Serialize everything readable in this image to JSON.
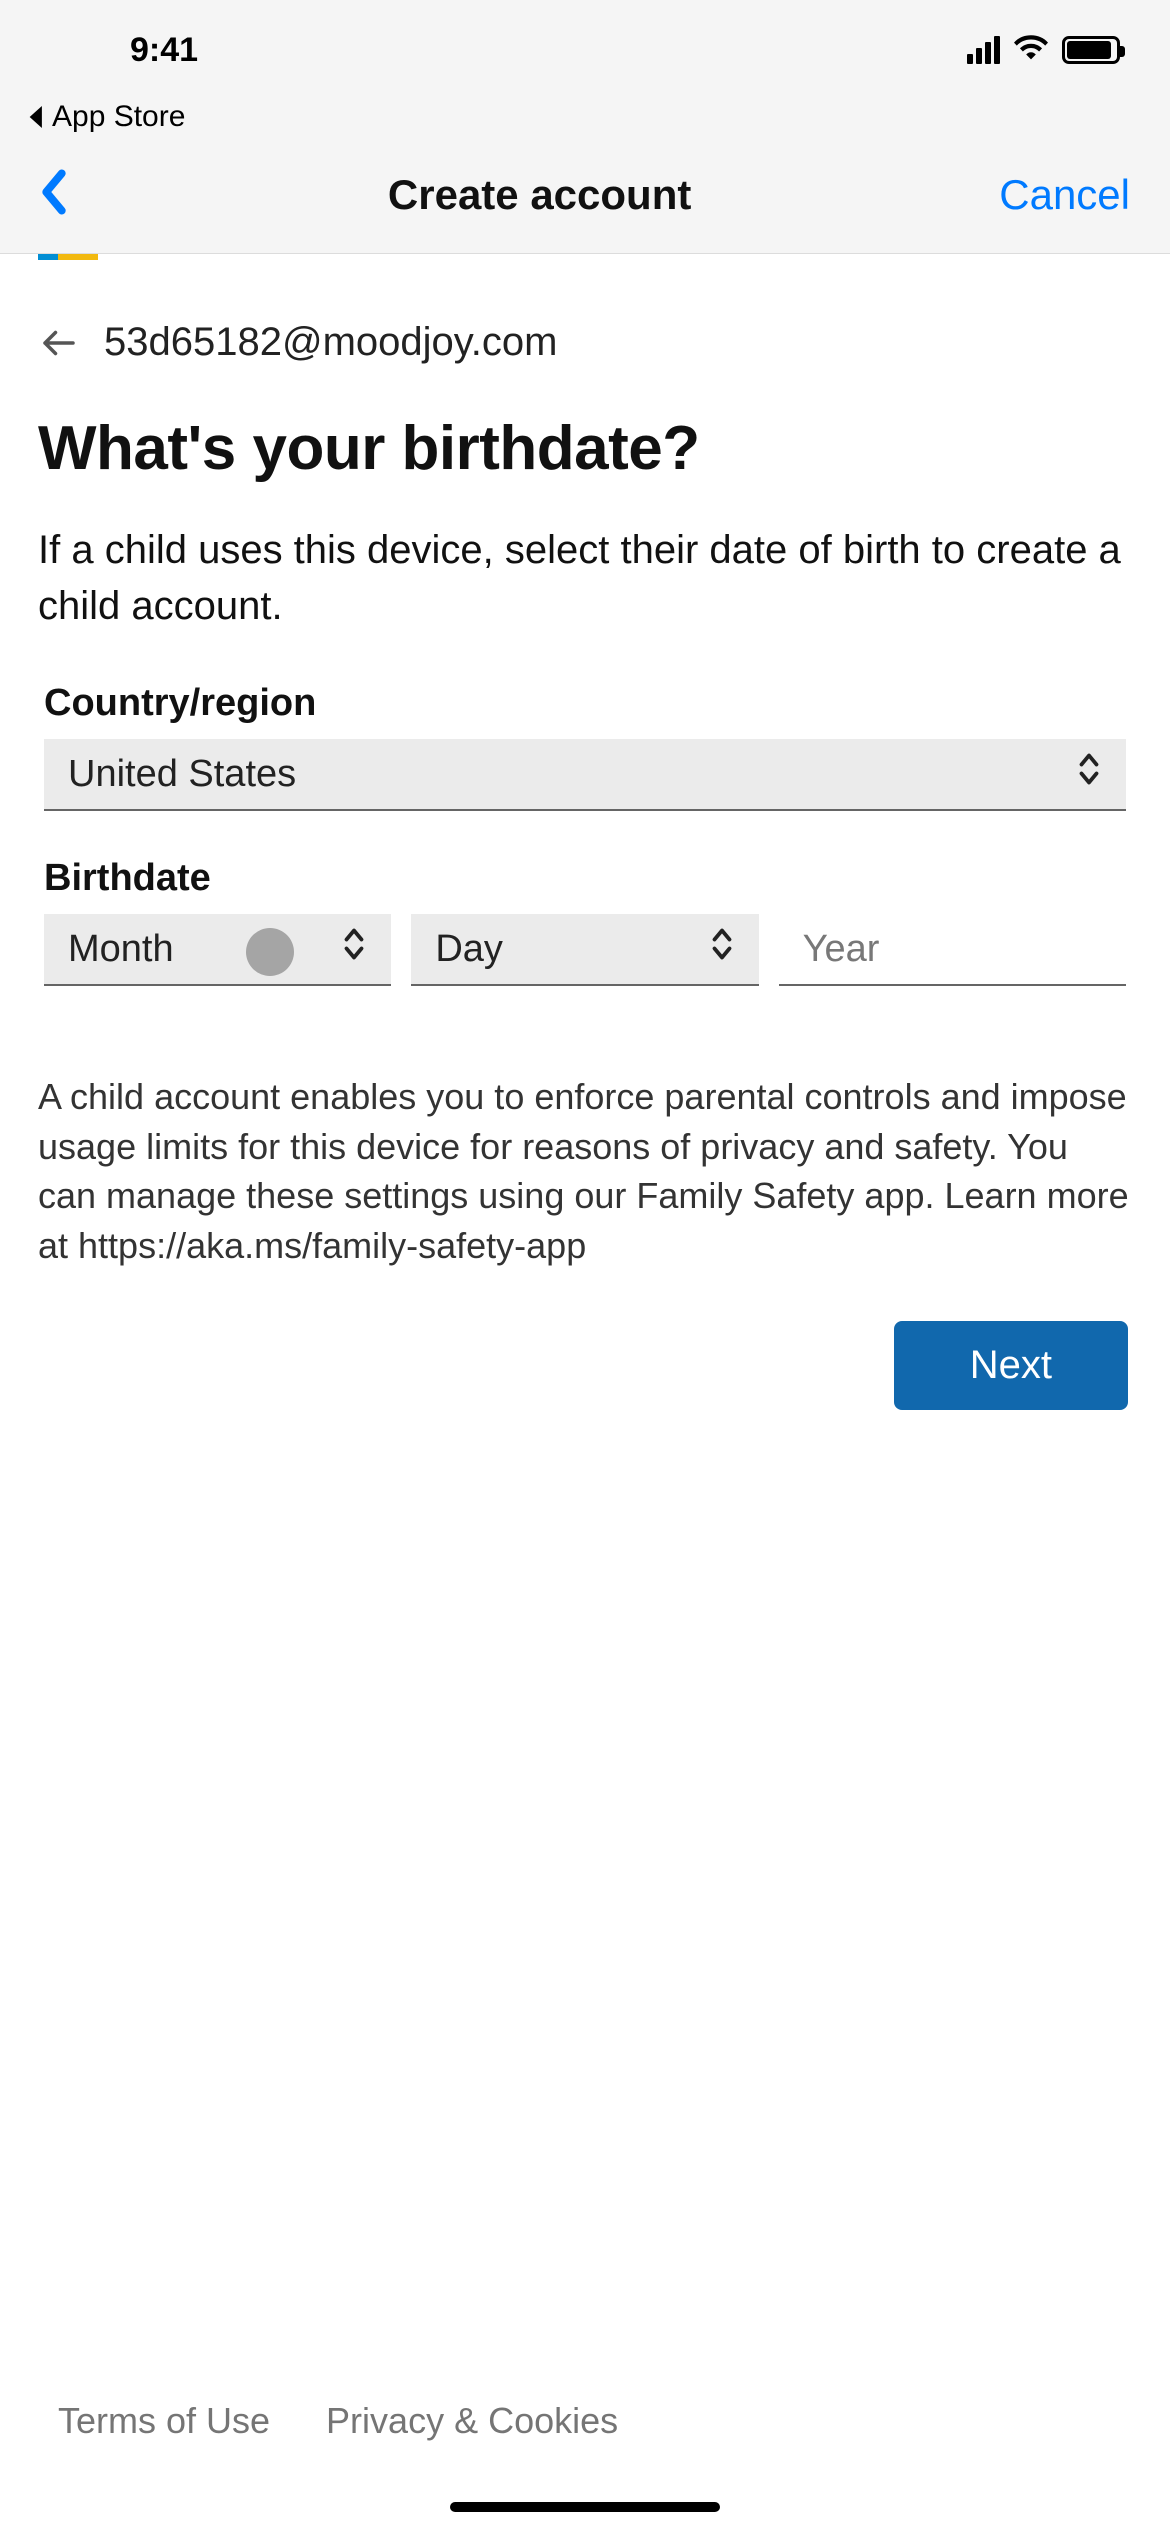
{
  "status": {
    "time": "9:41"
  },
  "return_app": {
    "label": "App Store"
  },
  "nav": {
    "title": "Create account",
    "cancel": "Cancel"
  },
  "account": {
    "email": "53d65182@moodjoy.com"
  },
  "heading": "What's your birthdate?",
  "instruction": "If a child uses this device, select their date of birth to create a child account.",
  "fields": {
    "country_label": "Country/region",
    "country_value": "United States",
    "birthdate_label": "Birthdate",
    "month_placeholder": "Month",
    "day_placeholder": "Day",
    "year_placeholder": "Year"
  },
  "info_text": "A child account enables you to enforce parental controls and impose usage limits for this device for reasons of privacy and safety. You can manage these settings using our Family Safety app. Learn more at https://aka.ms/family-safety-app",
  "next_button": "Next",
  "footer": {
    "terms": "Terms of Use",
    "privacy": "Privacy & Cookies"
  }
}
